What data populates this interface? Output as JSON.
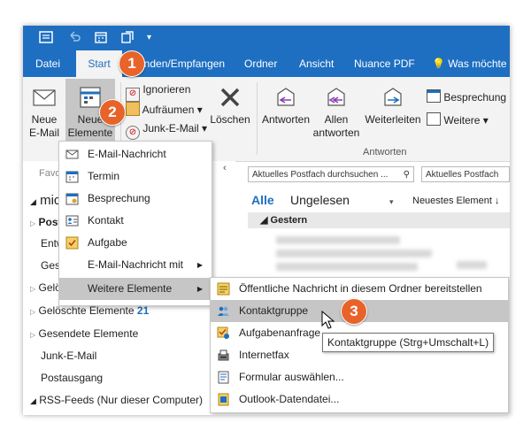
{
  "titlebar": {
    "dropdown_glyph": "▾"
  },
  "tabs": {
    "datei": "Datei",
    "start": "Start",
    "senden": "Senden/Empfangen",
    "ordner": "Ordner",
    "ansicht": "Ansicht",
    "nuance": "Nuance PDF",
    "tellme": "Was möchte"
  },
  "ribbon": {
    "neue_email": [
      "Neue",
      "E-Mail"
    ],
    "neue_elemente": [
      "Neue",
      "Elemente ▾"
    ],
    "ignorieren": "Ignorieren",
    "aufraeumen": "Aufräumen ▾",
    "junk": "Junk-E-Mail ▾",
    "loeschen": "Löschen",
    "antworten": "Antworten",
    "allen": [
      "Allen",
      "antworten"
    ],
    "weiterleiten": "Weiterleiten",
    "besprechung": "Besprechung",
    "weitere": "Weitere ▾",
    "group_antworten": "Antworten"
  },
  "nav": {
    "favoriten": "Favor",
    "account": "mic",
    "post": "Post",
    "entw": "Entw",
    "gese": "Gese",
    "gelo": "Gelö",
    "geloeschte": "Gelöschte Elemente",
    "geloeschte_count": "21",
    "gesendete": "Gesendete Elemente",
    "junk": "Junk-E-Mail",
    "postausgang": "Postausgang",
    "rss": "RSS-Feeds (Nur dieser Computer)"
  },
  "mail": {
    "search_placeholder": "Aktuelles Postfach durchsuchen ...",
    "search_scope": "Aktuelles Postfach",
    "filter_all": "Alle",
    "filter_unread": "Ungelesen",
    "sort": "Neuestes Element ↓",
    "group_yesterday": "Gestern"
  },
  "menu1": {
    "items": [
      {
        "label": "E-Mail-Nachricht",
        "icon": "mail-icon"
      },
      {
        "label": "Termin",
        "icon": "calendar-icon"
      },
      {
        "label": "Besprechung",
        "icon": "meeting-icon"
      },
      {
        "label": "Kontakt",
        "icon": "contact-icon"
      },
      {
        "label": "Aufgabe",
        "icon": "task-icon"
      },
      {
        "label": "E-Mail-Nachricht mit",
        "icon": ""
      },
      {
        "label": "Weitere Elemente",
        "icon": ""
      }
    ]
  },
  "menu2": {
    "items": [
      {
        "label": "Öffentliche Nachricht in diesem Ordner bereitstellen",
        "icon": "post-icon"
      },
      {
        "label": "Kontaktgruppe",
        "icon": "contact-group-icon"
      },
      {
        "label": "Aufgabenanfrage",
        "icon": "task-request-icon"
      },
      {
        "label": "Internetfax",
        "icon": "fax-icon"
      },
      {
        "label": "Formular auswählen...",
        "icon": "form-icon"
      },
      {
        "label": "Outlook-Datendatei...",
        "icon": "data-file-icon"
      }
    ]
  },
  "tooltip": "Kontaktgruppe (Strg+Umschalt+L)",
  "callouts": [
    "1",
    "2",
    "3"
  ],
  "colors": {
    "accent": "#1e6fc1",
    "callout": "#e8632a",
    "highlight": "#c6c6c6"
  }
}
